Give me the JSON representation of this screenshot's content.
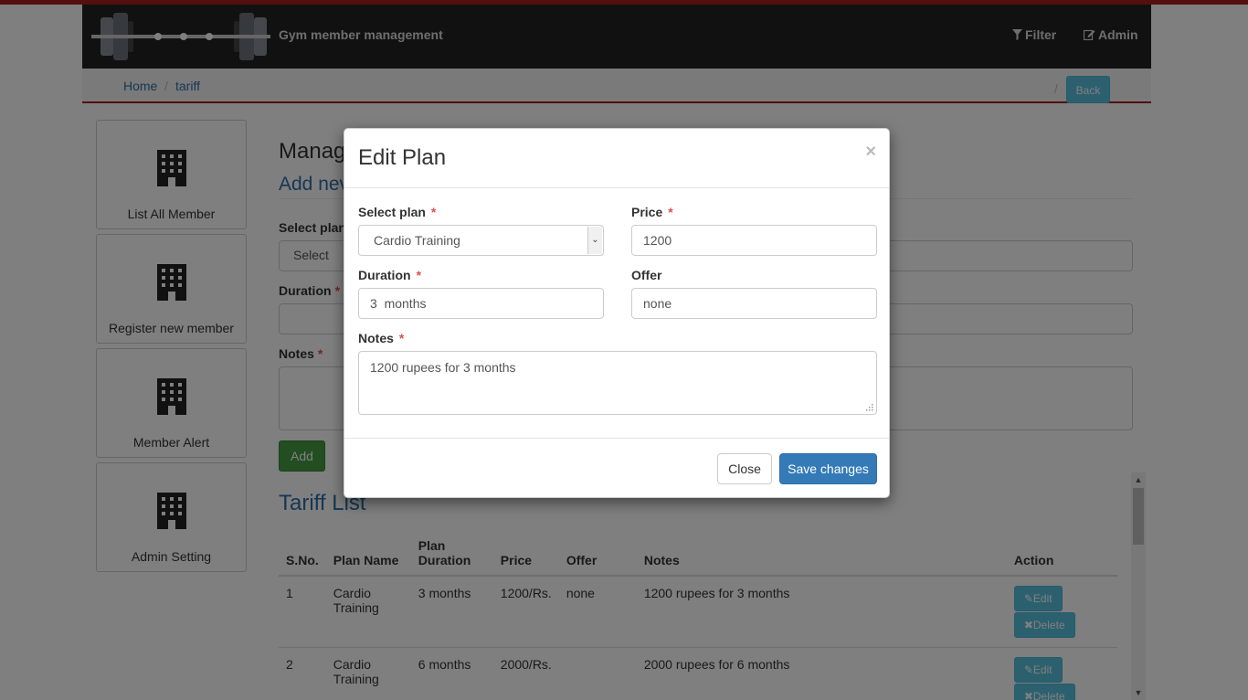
{
  "header": {
    "brand": "Gym member management",
    "filter_label": "Filter",
    "admin_label": "Admin"
  },
  "breadcrumb": {
    "home": "Home",
    "current": "tariff",
    "back_label": "Back"
  },
  "sidebar": {
    "items": [
      {
        "label": "List All Member",
        "icon": "building-icon"
      },
      {
        "label": "Register new member",
        "icon": "building-icon"
      },
      {
        "label": "Member Alert",
        "icon": "building-icon"
      },
      {
        "label": "Admin Setting",
        "icon": "building-icon"
      }
    ]
  },
  "main": {
    "manage_heading": "Manag",
    "add_heading": "Add nev",
    "select_plan_label": "Select plan",
    "select_placeholder": "Select",
    "duration_label": "Duration",
    "notes_label": "Notes",
    "add_button": "Add",
    "tariff_heading": "Tariff List"
  },
  "table": {
    "headers": [
      "S.No.",
      "Plan Name",
      "Plan Duration",
      "Price",
      "Offer",
      "Notes",
      "Action"
    ],
    "rows": [
      {
        "sno": "1",
        "plan": "Cardio Training",
        "duration": "3 months",
        "price": "1200/Rs.",
        "offer": "none",
        "notes": "1200 rupees for 3 months"
      },
      {
        "sno": "2",
        "plan": "Cardio Training",
        "duration": "6 months",
        "price": "2000/Rs.",
        "offer": "",
        "notes": "2000 rupees for 6 months"
      }
    ],
    "edit_label": "Edit",
    "delete_label": "Delete"
  },
  "modal": {
    "title": "Edit Plan",
    "close_x": "×",
    "select_plan_label": "Select plan",
    "select_plan_value": "Cardio Training",
    "price_label": "Price",
    "price_value": "1200",
    "duration_label": "Duration",
    "duration_value": "3  months",
    "offer_label": "Offer",
    "offer_value": "none",
    "notes_label": "Notes",
    "notes_value": "1200 rupees for 3 months",
    "close_button": "Close",
    "save_button": "Save changes",
    "required_mark": "*"
  },
  "colors": {
    "accent_red": "#a81e1e",
    "navbar_bg": "#222222",
    "primary": "#337ab7",
    "info": "#5bc0de",
    "success": "#449d44"
  }
}
